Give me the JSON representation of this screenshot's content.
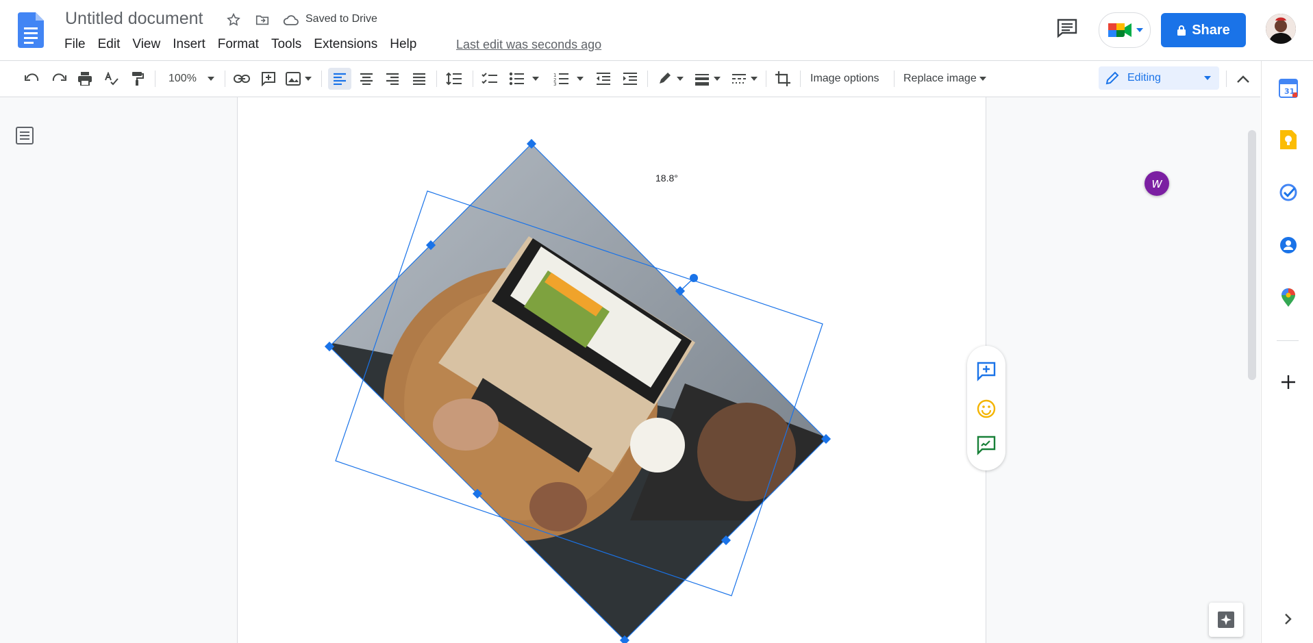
{
  "header": {
    "title": "Untitled document",
    "saved_status": "Saved to Drive",
    "last_edit": "Last edit was seconds ago",
    "share_label": "Share",
    "menu": [
      {
        "label": "File"
      },
      {
        "label": "Edit"
      },
      {
        "label": "View"
      },
      {
        "label": "Insert"
      },
      {
        "label": "Format"
      },
      {
        "label": "Tools"
      },
      {
        "label": "Extensions"
      },
      {
        "label": "Help"
      }
    ]
  },
  "toolbar": {
    "zoom": "100%",
    "image_options": "Image options",
    "replace_image": "Replace image",
    "mode": "Editing"
  },
  "canvas": {
    "rotation_angle": "18.8°",
    "image_description": "Rotated photo of a person typing on a laptop on a wooden table with a coffee cup"
  },
  "colors": {
    "accent": "#1a73e8",
    "selection": "#1a73e8"
  },
  "icons": [
    "undo-icon",
    "redo-icon",
    "print-icon",
    "spellcheck-icon",
    "paint-format-icon",
    "link-icon",
    "add-comment-icon",
    "insert-image-icon",
    "align-left-icon",
    "align-center-icon",
    "align-right-icon",
    "justify-icon",
    "line-spacing-icon",
    "checklist-icon",
    "bulleted-list-icon",
    "numbered-list-icon",
    "decrease-indent-icon",
    "increase-indent-icon",
    "border-color-icon",
    "border-weight-icon",
    "border-dash-icon",
    "crop-icon"
  ]
}
